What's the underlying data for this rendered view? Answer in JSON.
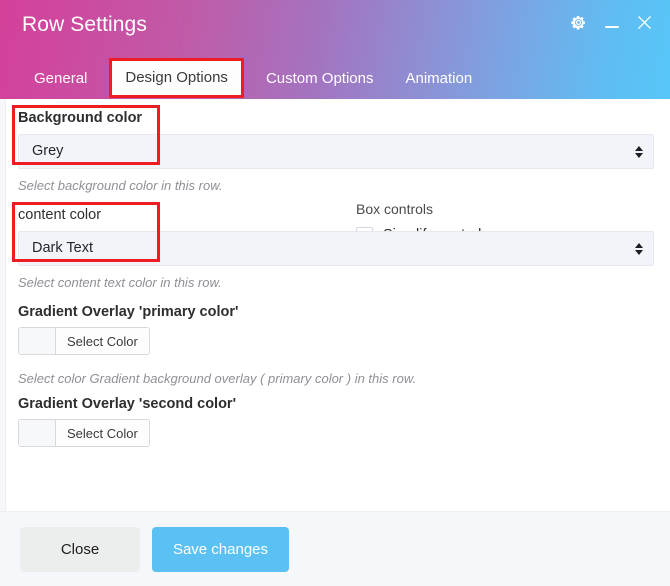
{
  "window": {
    "title": "Row Settings",
    "controls": [
      {
        "name": "settings-gear",
        "icon": "gear-icon"
      },
      {
        "name": "minimize",
        "icon": "minimize-icon"
      },
      {
        "name": "close",
        "icon": "close-icon"
      }
    ]
  },
  "tabs": [
    {
      "label": "General",
      "active": false
    },
    {
      "label": "Design Options",
      "active": true
    },
    {
      "label": "Custom Options",
      "active": false
    },
    {
      "label": "Animation",
      "active": false
    }
  ],
  "box_controls": {
    "label": "Box controls",
    "checkbox_label": "Simplify controls",
    "checked": false
  },
  "fields": {
    "background_color": {
      "label": "Background color",
      "value": "Grey",
      "help": "Select background color in this row."
    },
    "content_color": {
      "label": "content color",
      "value": "Dark Text",
      "help": "Select content text color in this row."
    },
    "gradient_primary": {
      "label": "Gradient Overlay 'primary color'",
      "button_label": "Select Color",
      "help": "Select color Gradient background overlay ( primary color ) in this row."
    },
    "gradient_second": {
      "label": "Gradient Overlay 'second color'",
      "button_label": "Select Color"
    }
  },
  "footer": {
    "close_label": "Close",
    "save_label": "Save changes"
  },
  "colors": {
    "header_start": "#d4419a",
    "header_end": "#57c6f8",
    "accent_blue": "#5bc0f2",
    "highlight_red": "#ee1c23",
    "select_bg": "#f3f4f9"
  }
}
